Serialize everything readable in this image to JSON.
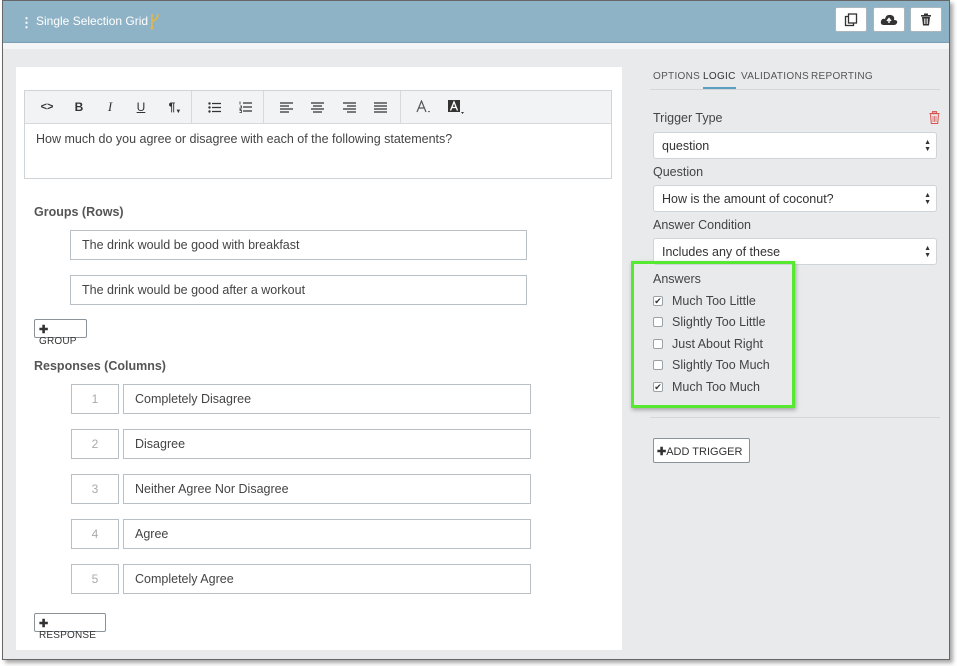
{
  "header": {
    "title": "Single Selection Grid",
    "buttons": [
      "copy-icon",
      "cloud-upload-icon",
      "trash-icon"
    ]
  },
  "editor": {
    "toolbar": {
      "code": "<>",
      "bold": "B",
      "italic": "I",
      "underline": "U",
      "paragraph": "¶"
    },
    "text": "How much do you agree or disagree with each of the following statements?"
  },
  "groups": {
    "label": "Groups (Rows)",
    "items": [
      "The drink would be good with breakfast",
      "The drink would be good after a workout"
    ],
    "add_label": "GROUP"
  },
  "responses": {
    "label": "Responses (Columns)",
    "items": [
      {
        "num": "1",
        "text": "Completely Disagree"
      },
      {
        "num": "2",
        "text": "Disagree"
      },
      {
        "num": "3",
        "text": "Neither Agree Nor Disagree"
      },
      {
        "num": "4",
        "text": "Agree"
      },
      {
        "num": "5",
        "text": "Completely Agree"
      }
    ],
    "add_label": "RESPONSE"
  },
  "right": {
    "tabs": [
      "OPTIONS",
      "LOGIC",
      "VALIDATIONS",
      "REPORTING"
    ],
    "active_tab": "LOGIC",
    "trigger_type_label": "Trigger Type",
    "trigger_type_value": "question",
    "question_label": "Question",
    "question_value": "How is the amount of coconut?",
    "answer_condition_label": "Answer Condition",
    "answer_condition_value": "Includes any of these",
    "answers_label": "Answers",
    "answers": [
      {
        "label": "Much Too Little",
        "checked": true
      },
      {
        "label": "Slightly Too Little",
        "checked": false
      },
      {
        "label": "Just About Right",
        "checked": false
      },
      {
        "label": "Slightly Too Much",
        "checked": false
      },
      {
        "label": "Much Too Much",
        "checked": true
      }
    ],
    "add_trigger_label": "ADD TRIGGER",
    "highlight_color": "#57e832",
    "delete_color": "#d9534f"
  }
}
